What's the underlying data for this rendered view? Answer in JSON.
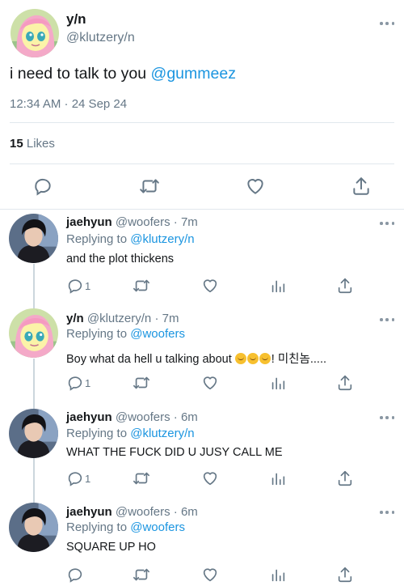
{
  "main_tweet": {
    "display_name": "y/n",
    "handle": "@klutzery/n",
    "text_prefix": "i need to talk to you ",
    "mention": "@gummeez",
    "timestamp": "12:34 AM · 24 Sep 24",
    "like_count": "15",
    "like_label": " Likes"
  },
  "replies": [
    {
      "display_name": "jaehyun",
      "handle_time": "@woofers · 7m",
      "replying_label": "Replying to ",
      "replying_to": "@klutzery/n",
      "text": "and the plot thickens",
      "text_suffix": "",
      "reply_count": "1",
      "avatar": "dark-haired-guy"
    },
    {
      "display_name": "y/n",
      "handle_time": "@klutzery/n · 7m",
      "replying_label": "Replying to ",
      "replying_to": "@woofers",
      "text": "Boy what da hell u talking about ",
      "text_suffix": "! 미친놈.....",
      "reply_count": "1",
      "avatar": "pink-pony"
    },
    {
      "display_name": "jaehyun",
      "handle_time": "@woofers · 6m",
      "replying_label": "Replying to ",
      "replying_to": "@klutzery/n",
      "text": "WHAT THE FUCK DID U JUSY CALL ME",
      "text_suffix": "",
      "reply_count": "1",
      "avatar": "dark-haired-guy"
    },
    {
      "display_name": "jaehyun",
      "handle_time": "@woofers · 6m",
      "replying_label": "Replying to ",
      "replying_to": "@woofers",
      "text": "SQUARE UP HO",
      "text_suffix": "",
      "reply_count": "",
      "avatar": "dark-haired-guy"
    }
  ],
  "colors": {
    "link": "#1b95e0",
    "muted": "#657786",
    "icon": "#657786",
    "divider": "#e1e8ed"
  },
  "icons": [
    "more-icon",
    "reply-icon",
    "retweet-icon",
    "like-icon",
    "share-icon",
    "analytics-icon",
    "laughing-emoji"
  ]
}
